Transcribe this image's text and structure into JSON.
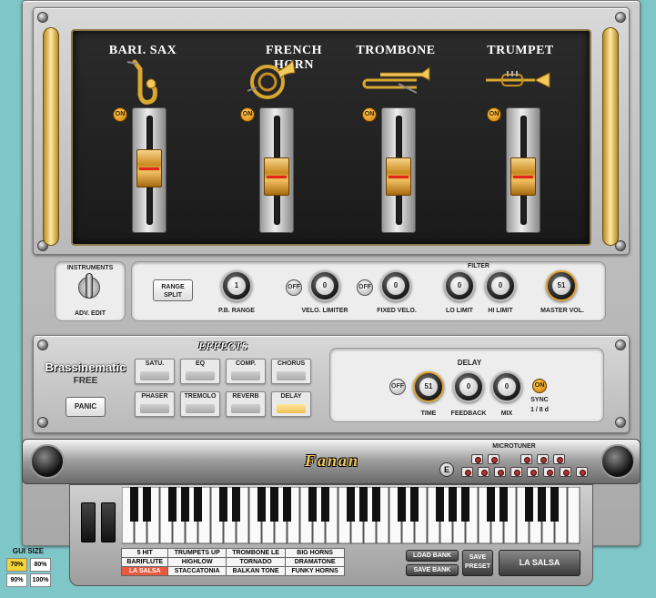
{
  "instruments": [
    {
      "name": "BARI. SAX",
      "on": "ON",
      "level": 0.57
    },
    {
      "name": "FRENCH HORN",
      "on": "ON",
      "level": 0.47
    },
    {
      "name": "TROMBONE",
      "on": "ON",
      "level": 0.47
    },
    {
      "name": "TRUMPET",
      "on": "ON",
      "level": 0.47
    }
  ],
  "controls": {
    "instruments_label": "INSTRUMENTS",
    "adv_edit": "ADV. EDIT",
    "range_split": "RANGE SPLIT",
    "pb_range": {
      "label": "P.B. RANGE",
      "value": "1"
    },
    "velo_limiter": {
      "label": "VELO. LIMITER",
      "value": "0",
      "switch": "OFF"
    },
    "fixed_velo": {
      "label": "FIXED VELO.",
      "value": "0",
      "switch": "OFF"
    },
    "filter_label": "FILTER",
    "lo_limit": {
      "label": "LO LIMIT",
      "value": "0"
    },
    "hi_limit": {
      "label": "HI LIMIT",
      "value": "0"
    },
    "master_vol": {
      "label": "MASTER VOL.",
      "value": "51"
    }
  },
  "brand": {
    "name": "Brassinematic",
    "edition": "FREE"
  },
  "panic": "PANIC",
  "effects": {
    "title": "EFFECTS",
    "buttons": [
      "SATU.",
      "EQ",
      "COMP.",
      "CHORUS",
      "PHASER",
      "TREMOLO",
      "REVERB",
      "DELAY"
    ]
  },
  "delay": {
    "title": "DELAY",
    "switch": "OFF",
    "time": {
      "label": "TIME",
      "value": "51"
    },
    "feedback": {
      "label": "FEEDBACK",
      "value": "0"
    },
    "mix": {
      "label": "MIX",
      "value": "0"
    },
    "sync": {
      "label": "SYNC",
      "switch": "ON",
      "value": "1 / 8 d"
    }
  },
  "logo": "Fanan",
  "microtuner": {
    "label": "MICROTUNER",
    "e_button": "E"
  },
  "presets": [
    [
      "5 HIT",
      "TRUMPETS UP",
      "TROMBONE LE",
      "BIG HORNS"
    ],
    [
      "BARIFLUTE",
      "HIGHLOW",
      "TORNADO",
      "DRAMATONE"
    ],
    [
      "LA SALSA",
      "STACCATONIA",
      "BALKAN TONE",
      "FUNKY HORNS"
    ]
  ],
  "selected_preset": "LA SALSA",
  "bank": {
    "load": "LOAD BANK",
    "save": "SAVE BANK",
    "save_preset": "SAVE PRESET",
    "current": "LA SALSA"
  },
  "gui_size": {
    "label": "GUI SIZE",
    "options": [
      "70%",
      "80%",
      "90%",
      "100%"
    ],
    "selected": "70%"
  },
  "colors": {
    "accent": "#f0b030",
    "selected_preset": "#e85a3f",
    "display_bg": "#222222"
  }
}
